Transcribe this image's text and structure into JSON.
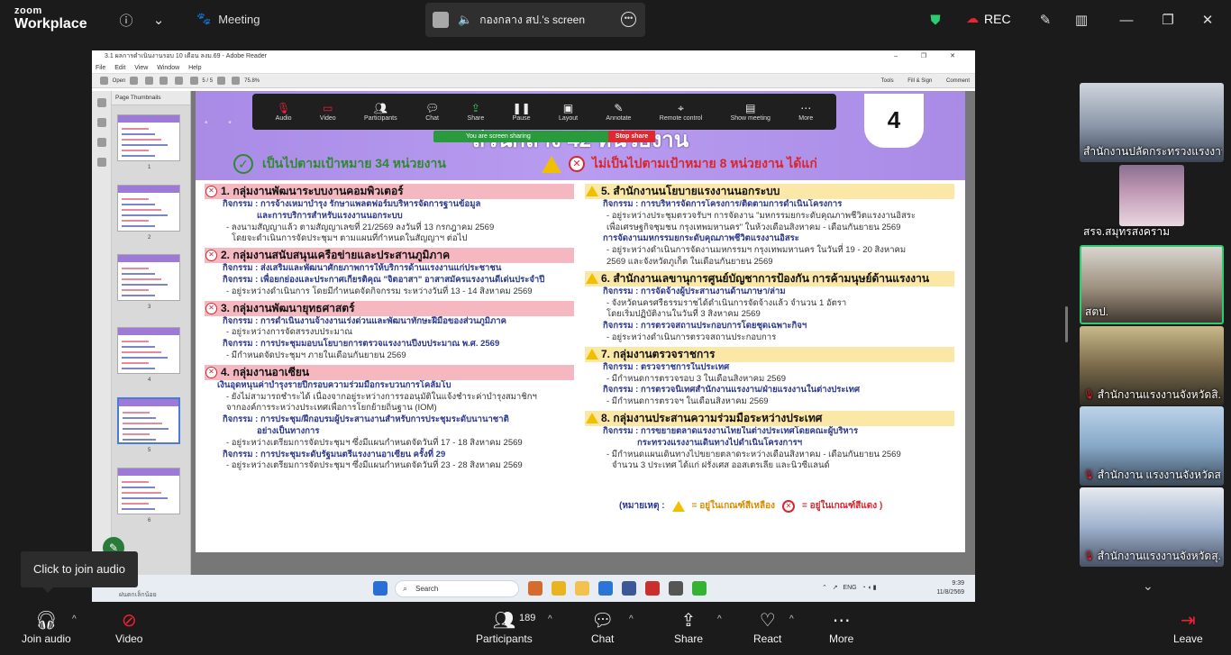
{
  "topbar": {
    "logo_small": "zoom",
    "logo_big": "Workplace",
    "meeting_label": "Meeting",
    "share_title": "กองกลาง สป.'s screen",
    "rec_label": "REC",
    "leave_label": "Leave"
  },
  "reader": {
    "title": "3.1 ผลการดำเนินงานรอบ 10 เดือน ลงม.69 - Adobe Reader",
    "menu": [
      "File",
      "Edit",
      "View",
      "Window",
      "Help"
    ],
    "open_label": "Open",
    "page_current": "5",
    "page_total": "5",
    "zoom": "75.8%",
    "tools": [
      "Tools",
      "Fill & Sign",
      "Comment"
    ],
    "thumbs_header": "Page Thumbnails",
    "thumb_numbers": [
      "1",
      "2",
      "3",
      "4",
      "5",
      "6"
    ]
  },
  "slide": {
    "page_number": "4",
    "title": "ส่วนกลาง 42 หน่วยงาน",
    "ok_header": "เป็นไปตามเป้าหมาย  34  หน่วยงาน",
    "bad_header": "ไม่เป็นไปตามเป้าหมาย  8  หน่วยงาน  ได้แก่",
    "left": [
      {
        "title": "1. กลุ่มงานพัฒนาระบบงานคอมพิวเตอร์",
        "lines": [
          {
            "k": "act",
            "t": "กิจกรรม : การจ้างเหมาบำรุง รักษาแพลตฟอร์มบริหารจัดการฐานข้อมูล"
          },
          {
            "k": "act2",
            "t": "และการบริการสำหรับแรงงานนอกระบบ"
          },
          {
            "k": "sub",
            "t": "- ลงนามสัญญาแล้ว ตามสัญญาเลขที่ 21/2569 ลงวันที่ 13 กรกฎาคม 2569"
          },
          {
            "k": "sub2",
            "t": "โดยจะดำเนินการจัดประชุมฯ ตามแผนที่กำหนดในสัญญาฯ ต่อไป"
          }
        ]
      },
      {
        "title": "2. กลุ่มงานสนับสนุนเครือข่ายและประสานภูมิภาค",
        "lines": [
          {
            "k": "act",
            "t": "กิจกรรม : ส่งเสริมและพัฒนาศักยภาพการให้บริการด้านแรงงานแก่ประชาชน"
          },
          {
            "k": "act",
            "t": "กิจกรรม : เพื่อยกย่องและประกาศเกียรติคุณ \"จิตอาสา\" อาสาสมัครแรงงานดีเด่นประจำปี"
          },
          {
            "k": "sub",
            "t": "- อยู่ระหว่างดำเนินการ โดยมีกำหนดจัดกิจกรรม ระหว่างวันที่ 13 - 14 สิงหาคม 2569"
          }
        ]
      },
      {
        "title": "3. กลุ่มงานพัฒนายุทธศาสตร์",
        "lines": [
          {
            "k": "act",
            "t": "กิจกรรม : การดำเนินงานจ้างงานเร่งด่วนและพัฒนาทักษะฝีมือของส่วนภูมิภาค"
          },
          {
            "k": "sub",
            "t": "- อยู่ระหว่างการจัดสรรงบประมาณ"
          },
          {
            "k": "act",
            "t": "กิจกรรม : การประชุมมอบนโยบายการตรวจแรงงานปีงบประมาณ พ.ศ. 2569"
          },
          {
            "k": "sub",
            "t": "- มีกำหนดจัดประชุมฯ ภายในเดือนกันยายน 2569"
          }
        ]
      },
      {
        "title": "4. กลุ่มงานอาเซียน",
        "lines": [
          {
            "k": "blue",
            "t": "เงินอุดหนุนค่าบำรุงรายปีกรอบความร่วมมือกระบวนการโคลัมโบ"
          },
          {
            "k": "sub",
            "t": "- ยังไม่สามารถชำระได้ เนื่องจากอยู่ระหว่างการรออนุมัติในแจ้งชำระค่าบำรุงสมาชิกฯ"
          },
          {
            "k": "sub",
            "t": "จากองค์การระหว่างประเทศเพื่อการโยกย้ายถิ่นฐาน (IOM)"
          },
          {
            "k": "act",
            "t": "กิจกรรม : การประชุม/ฝึกอบรมผู้ประสานงานสำหรับการประชุมระดับนานาชาติ"
          },
          {
            "k": "act2",
            "t": "อย่างเป็นทางการ"
          },
          {
            "k": "sub",
            "t": "- อยู่ระหว่างเตรียมการจัดประชุมฯ ซึ่งมีแผนกำหนดจัดวันที่ 17 - 18 สิงหาคม 2569"
          },
          {
            "k": "act",
            "t": "กิจกรรม : การประชุมระดับรัฐมนตรีแรงงานอาเซียน ครั้งที่ 29"
          },
          {
            "k": "sub",
            "t": "- อยู่ระหว่างเตรียมการจัดประชุมฯ ซึ่งมีแผนกำหนดจัดวันที่ 23 - 28 สิงหาคม 2569"
          }
        ]
      }
    ],
    "right": [
      {
        "title": "5. สำนักงานนโยบายแรงงานนอกระบบ",
        "lines": [
          {
            "k": "act",
            "t": "กิจกรรม : การบริหารจัดการโครงการ/ติดตามการดำเนินโครงการ"
          },
          {
            "k": "sub",
            "t": "- อยู่ระหว่างประชุมตรวจรับฯ การจัดงาน \"มหกรรมยกระดับคุณภาพชีวิตแรงงานอิสระ"
          },
          {
            "k": "sub",
            "t": "เพื่อเศรษฐกิจชุมชน กรุงเทพมหานคร\" ในห้วงเดือนสิงหาคม - เดือนกันยายน 2569"
          },
          {
            "k": "act",
            "t": "การจัดงานมหกรรมยกระดับคุณภาพชีวิตแรงงานอิสระ"
          },
          {
            "k": "sub",
            "t": "- อยู่ระหว่างดำเนินการจัดงานมหกรรมฯ กรุงเทพมหานคร ในวันที่ 19 - 20 สิงหาคม"
          },
          {
            "k": "sub",
            "t": "2569 และจังหวัดภูเก็ต ในเดือนกันยายน 2569"
          }
        ]
      },
      {
        "title": "6. สำนักงานเลขานุการศูนย์บัญชาการป้องกัน การค้ามนุษย์ด้านแรงงาน",
        "lines": [
          {
            "k": "act",
            "t": "กิจกรรม : การจัดจ้างผู้ประสานงานด้านภาษา/ล่าม"
          },
          {
            "k": "sub",
            "t": "- จังหวัดนครศรีธรรมราชได้ดำเนินการจัดจ้างแล้ว จำนวน 1 อัตรา"
          },
          {
            "k": "sub",
            "t": "โดยเริ่มปฏิบัติงานในวันที่ 3 สิงหาคม 2569"
          },
          {
            "k": "act",
            "t": "กิจกรรม : การตรวจสถานประกอบการโดยชุดเฉพาะกิจฯ"
          },
          {
            "k": "sub",
            "t": "- อยู่ระหว่างดำเนินการตรวจสถานประกอบการ"
          }
        ]
      },
      {
        "title": "7. กลุ่มงานตรวจราชการ",
        "lines": [
          {
            "k": "act",
            "t": "กิจกรรม : ตรวจราชการในประเทศ"
          },
          {
            "k": "sub",
            "t": "- มีกำหนดการตรวจรอบ 3 ในเดือนสิงหาคม 2569"
          },
          {
            "k": "act",
            "t": "กิจกรรม : การตรวจนิเทศสำนักงานแรงงาน/ฝ่ายแรงงานในต่างประเทศ"
          },
          {
            "k": "sub",
            "t": "- มีกำหนดการตรวจฯ ในเดือนสิงหาคม 2569"
          }
        ]
      },
      {
        "title": "8. กลุ่มงานประสานความร่วมมือระหว่างประเทศ",
        "lines": [
          {
            "k": "act",
            "t": "กิจกรรม : การขยายตลาดแรงงานไทยในต่างประเทศโดยคณะผู้บริหาร"
          },
          {
            "k": "act2",
            "t": "กระทรวงแรงงานเดินทางไปดำเนินโครงการฯ"
          },
          {
            "k": "sub",
            "t": "- มีกำหนดแผนเดินทางไปขยายตลาดระหว่างเดือนสิงหาคม - เดือนกันยายน 2569"
          },
          {
            "k": "sub2",
            "t": "จำนวน 3 ประเทศ ได้แก่ ฝรั่งเศส ออสเตรเลีย และนิวซีแลนด์"
          }
        ]
      }
    ],
    "note_prefix": "(หมายเหตุ :",
    "note_yellow": "= อยู่ในเกณฑ์สีเหลือง",
    "note_red": "= อยู่ในเกณฑ์สีแดง )"
  },
  "share_toolbar": {
    "items": [
      "Audio",
      "Video",
      "Participants",
      "Chat",
      "Share",
      "Pause",
      "Layout",
      "Annotate",
      "Remote control",
      "Show meeting",
      "More"
    ],
    "participants_count": "189",
    "sharing_text": "You are screen sharing",
    "stop_share": "Stop share"
  },
  "taskbar": {
    "search": "Search",
    "user": "ฝนตกเล็กน้อย",
    "lang": "ENG",
    "time": "9:39",
    "date": "11/8/2569"
  },
  "tooltip": "Click to join audio",
  "participants_strip": [
    {
      "name": "สำนักงานปลัดกระทรวงแรงงาน",
      "muted": false
    },
    {
      "name": "สรจ.สมุทรสงคราม",
      "muted": false
    },
    {
      "name": "สตป.",
      "muted": false
    },
    {
      "name": "สำนักงานแรงงานจังหวัดสิ...",
      "muted": true
    },
    {
      "name": "สำนักงาน แรงงานจังหวัดส...",
      "muted": true
    },
    {
      "name": "สำนักงานแรงงานจังหวัดสุ...",
      "muted": true
    }
  ],
  "bottombar": {
    "join_audio": "Join audio",
    "video": "Video",
    "participants": "Participants",
    "participants_count": "189",
    "chat": "Chat",
    "share": "Share",
    "react": "React",
    "more": "More",
    "leave": "Leave"
  }
}
